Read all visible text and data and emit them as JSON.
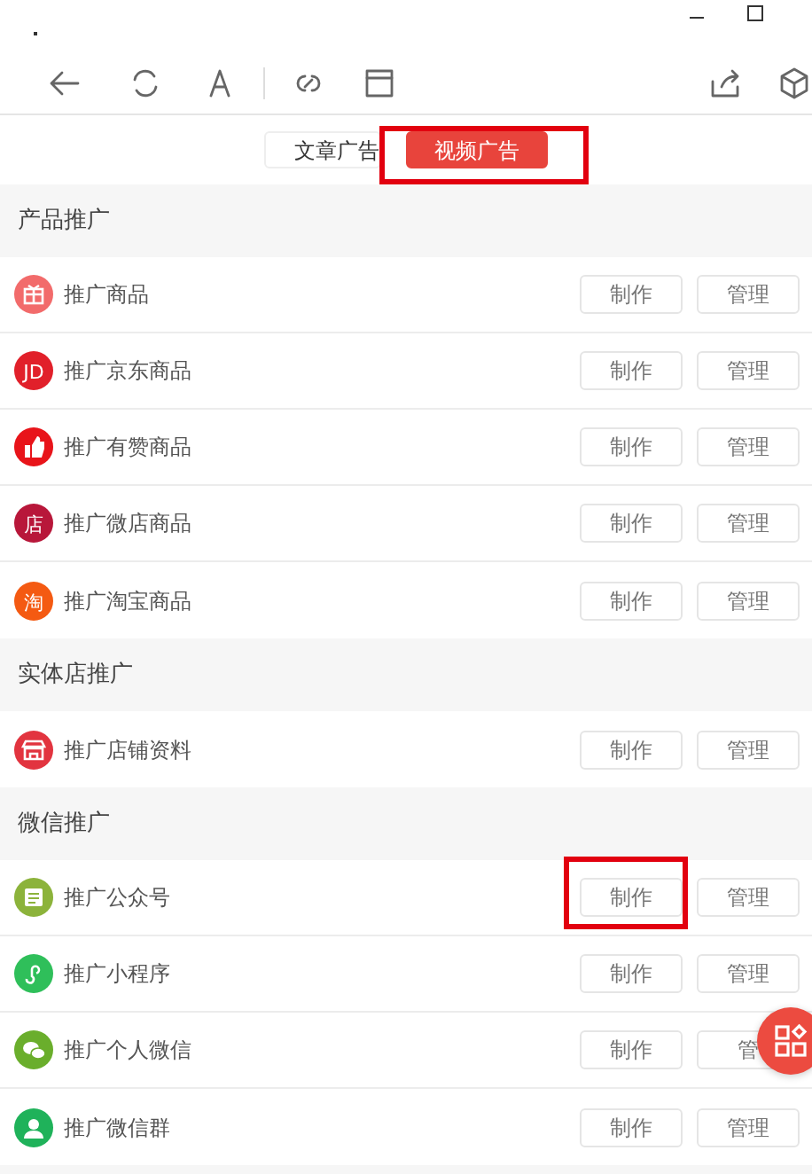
{
  "tabs": [
    {
      "label": "文章广告",
      "selected": false,
      "highlighted": false
    },
    {
      "label": "视频广告",
      "selected": true,
      "highlighted": true
    }
  ],
  "sections": [
    {
      "title": "产品推广",
      "items": [
        {
          "label": "推广商品",
          "kind": "gift",
          "color": "#f26b6b",
          "actions": [
            {
              "label": "制作",
              "highlighted": false
            },
            {
              "label": "管理",
              "highlighted": false
            }
          ]
        },
        {
          "label": "推广京东商品",
          "kind": "letters",
          "icon_text": "JD",
          "color": "#e1202a",
          "actions": [
            {
              "label": "制作",
              "highlighted": false
            },
            {
              "label": "管理",
              "highlighted": false
            }
          ]
        },
        {
          "label": "推广有赞商品",
          "kind": "thumb",
          "color": "#e8141a",
          "actions": [
            {
              "label": "制作",
              "highlighted": false
            },
            {
              "label": "管理",
              "highlighted": false
            }
          ]
        },
        {
          "label": "推广微店商品",
          "kind": "letters",
          "icon_text": "店",
          "color": "#b8173a",
          "actions": [
            {
              "label": "制作",
              "highlighted": false
            },
            {
              "label": "管理",
              "highlighted": false
            }
          ]
        },
        {
          "label": "推广淘宝商品",
          "kind": "letters",
          "icon_text": "淘",
          "color": "#f45a12",
          "actions": [
            {
              "label": "制作",
              "highlighted": false
            },
            {
              "label": "管理",
              "highlighted": false
            }
          ]
        }
      ]
    },
    {
      "title": "实体店推广",
      "items": [
        {
          "label": "推广店铺资料",
          "kind": "shop",
          "color": "#e2343f",
          "actions": [
            {
              "label": "制作",
              "highlighted": false
            },
            {
              "label": "管理",
              "highlighted": false
            }
          ]
        }
      ]
    },
    {
      "title": "微信推广",
      "items": [
        {
          "label": "推广公众号",
          "kind": "article",
          "color": "#8cb33b",
          "actions": [
            {
              "label": "制作",
              "highlighted": true
            },
            {
              "label": "管理",
              "highlighted": false
            }
          ]
        },
        {
          "label": "推广小程序",
          "kind": "miniapp",
          "color": "#2fbf5a",
          "actions": [
            {
              "label": "制作",
              "highlighted": false
            },
            {
              "label": "管理",
              "highlighted": false
            }
          ]
        },
        {
          "label": "推广个人微信",
          "kind": "wechat",
          "color": "#6aae2c",
          "actions": [
            {
              "label": "制作",
              "highlighted": false
            },
            {
              "label": "管",
              "highlighted": false
            }
          ]
        },
        {
          "label": "推广微信群",
          "kind": "person",
          "color": "#1fb25a",
          "actions": [
            {
              "label": "制作",
              "highlighted": false
            },
            {
              "label": "管理",
              "highlighted": false
            }
          ]
        }
      ]
    }
  ]
}
